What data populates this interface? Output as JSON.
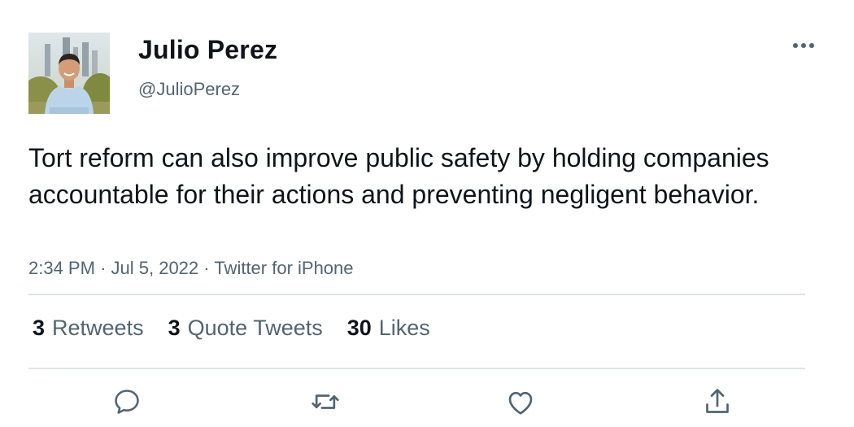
{
  "tweet": {
    "author": {
      "display_name": "Julio Perez",
      "handle": "@JulioPerez"
    },
    "text": "Tort reform can also improve public safety by holding companies accountable for their actions and preventing negligent behavior.",
    "meta": {
      "time": "2:34 PM",
      "separator": "·",
      "date": "Jul 5, 2022",
      "source": "Twitter for iPhone"
    },
    "stats": {
      "retweets_count": "3",
      "retweets_label": "Retweets",
      "quote_tweets_count": "3",
      "quote_tweets_label": "Quote Tweets",
      "likes_count": "30",
      "likes_label": "Likes"
    },
    "actions": [
      "reply-icon",
      "retweet-icon",
      "like-icon",
      "share-icon"
    ],
    "colors": {
      "text": "#0f1419",
      "secondary": "#536471",
      "divider": "#dfe3e6"
    }
  }
}
